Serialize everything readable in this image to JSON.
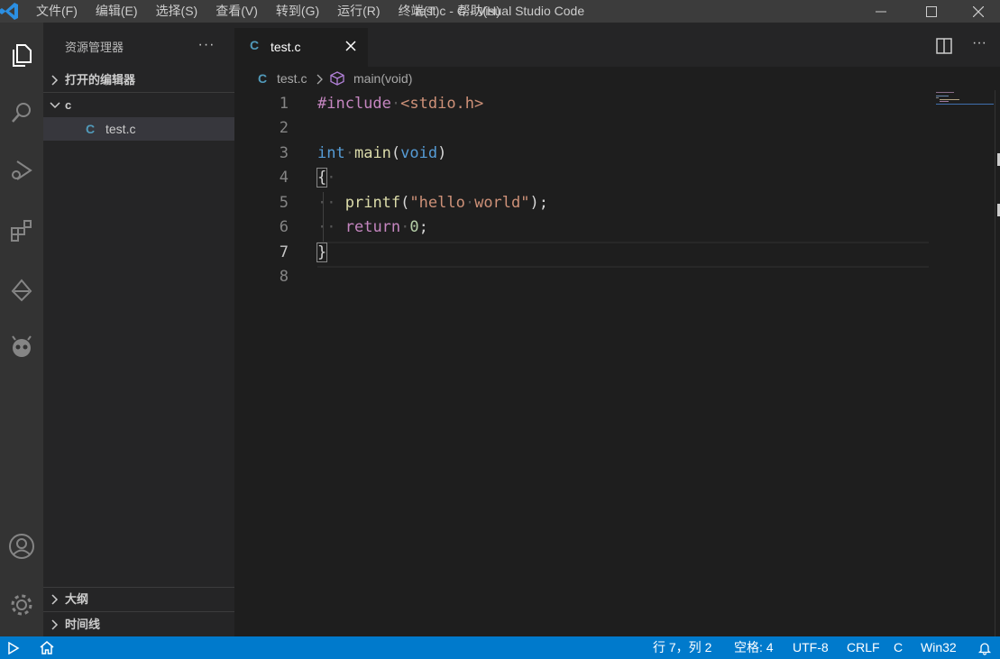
{
  "window": {
    "title": "test.c - C - Visual Studio Code",
    "menu": [
      "文件(F)",
      "编辑(E)",
      "选择(S)",
      "查看(V)",
      "转到(G)",
      "运行(R)",
      "终端(T)",
      "帮助(H)"
    ]
  },
  "activity_bar": {
    "items": [
      "explorer-icon",
      "search-icon",
      "run-debug-icon",
      "extensions-icon",
      "source-control-icon",
      "platformio-icon"
    ],
    "bottom_items": [
      "account-icon",
      "settings-gear-icon"
    ]
  },
  "sidebar": {
    "title": "资源管理器",
    "more": "···",
    "open_editors_label": "打开的编辑器",
    "folder_label": "c",
    "file_icon": "C",
    "file_name": "test.c",
    "outline_label": "大纲",
    "timeline_label": "时间线"
  },
  "tab": {
    "icon": "C",
    "label": "test.c"
  },
  "breadcrumb": {
    "file_icon": "C",
    "file": "test.c",
    "symbol": "main(void)"
  },
  "code": {
    "line_numbers": [
      "1",
      "2",
      "3",
      "4",
      "5",
      "6",
      "7",
      "8"
    ],
    "lines": [
      "#include <stdio.h>",
      "",
      "int main(void)",
      "{",
      "    printf(\"hello world\");",
      "    return 0;",
      "}",
      ""
    ]
  },
  "statusbar": {
    "position": "行 7，列 2",
    "spaces": "空格: 4",
    "encoding": "UTF-8",
    "eol": "CRLF",
    "language": "C",
    "platform": "Win32"
  },
  "colors": {
    "status_bg": "#007acc",
    "keyword_blue": "#569cd6",
    "keyword_purple": "#c586c0",
    "string": "#ce9178",
    "function": "#dcdcaa",
    "number": "#b5cea8"
  }
}
